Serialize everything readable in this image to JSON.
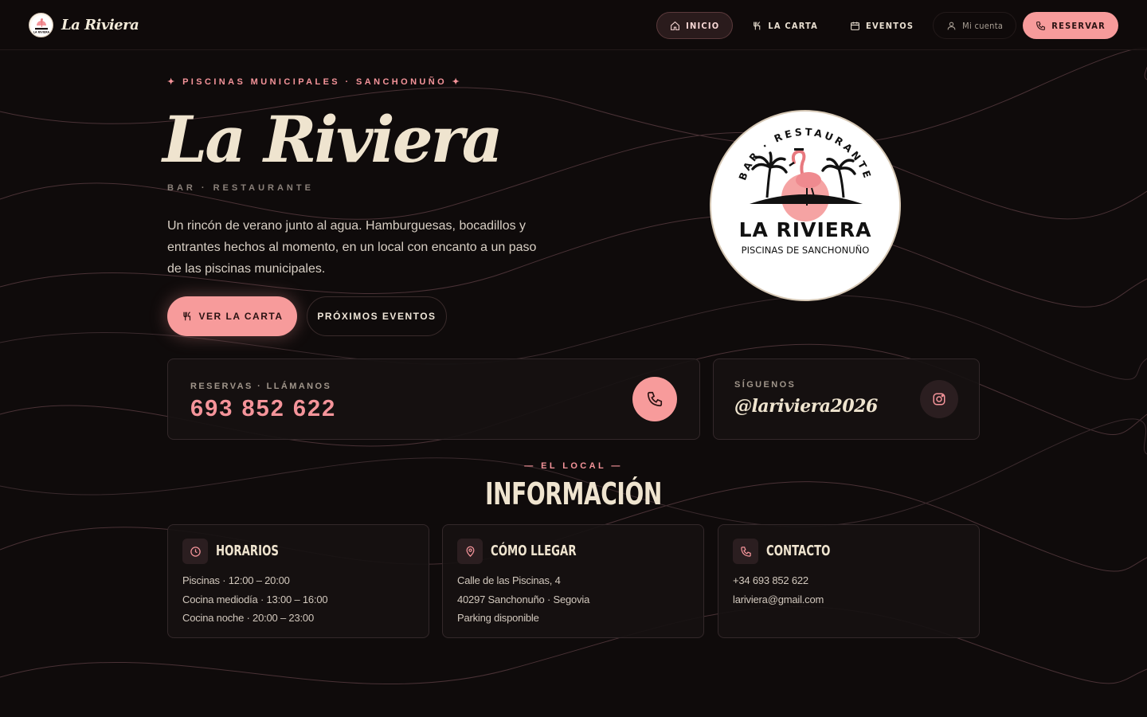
{
  "brand": {
    "name": "La Riviera",
    "logo_text": "LA RIVIERA"
  },
  "nav": {
    "items": [
      {
        "label": "INICIO",
        "icon": "home-icon"
      },
      {
        "label": "LA CARTA",
        "icon": "utensils-icon"
      },
      {
        "label": "EVENTOS",
        "icon": "calendar-icon"
      }
    ],
    "account_label": "Mi cuenta",
    "reserve_label": "RESERVAR"
  },
  "hero": {
    "eyebrow": "✦ PISCINAS MUNICIPALES · SANCHONUÑO ✦",
    "title": "La Riviera",
    "subtitle": "BAR · RESTAURANTE",
    "description": "Un rincón de verano junto al agua. Hamburguesas, bocadillos y entrantes hechos al momento, en un local con encanto a un paso de las piscinas municipales.",
    "primary_button": "VER LA CARTA",
    "secondary_button": "PRÓXIMOS EVENTOS"
  },
  "seal": {
    "arc_text": "BAR · RESTAURANTE",
    "name": "LA RIVIERA",
    "tagline": "PISCINAS DE SANCHONUÑO"
  },
  "reservations": {
    "label": "RESERVAS · LLÁMANOS",
    "phone": "693  852  622"
  },
  "social": {
    "label": "SÍGUENOS",
    "handle": "@lariviera2026"
  },
  "info_section": {
    "eyebrow": "— EL LOCAL —",
    "title": "INFORMACIÓN",
    "cards": [
      {
        "title": "HORARIOS",
        "icon": "clock-icon",
        "lines": [
          "Piscinas · 12:00 – 20:00",
          "Cocina mediodía · 13:00 – 16:00",
          "Cocina noche · 20:00 – 23:00"
        ]
      },
      {
        "title": "CÓMO LLEGAR",
        "icon": "map-pin-icon",
        "lines": [
          "Calle de las Piscinas, 4",
          "40297 Sanchonuño · Segovia",
          "Parking disponible"
        ]
      },
      {
        "title": "CONTACTO",
        "icon": "phone-icon",
        "lines": [
          "+34 693 852 622",
          "lariviera@gmail.com"
        ]
      }
    ]
  },
  "colors": {
    "accent": "#f79b9b",
    "background": "#0f0b0b",
    "cream": "#efe4cf"
  }
}
